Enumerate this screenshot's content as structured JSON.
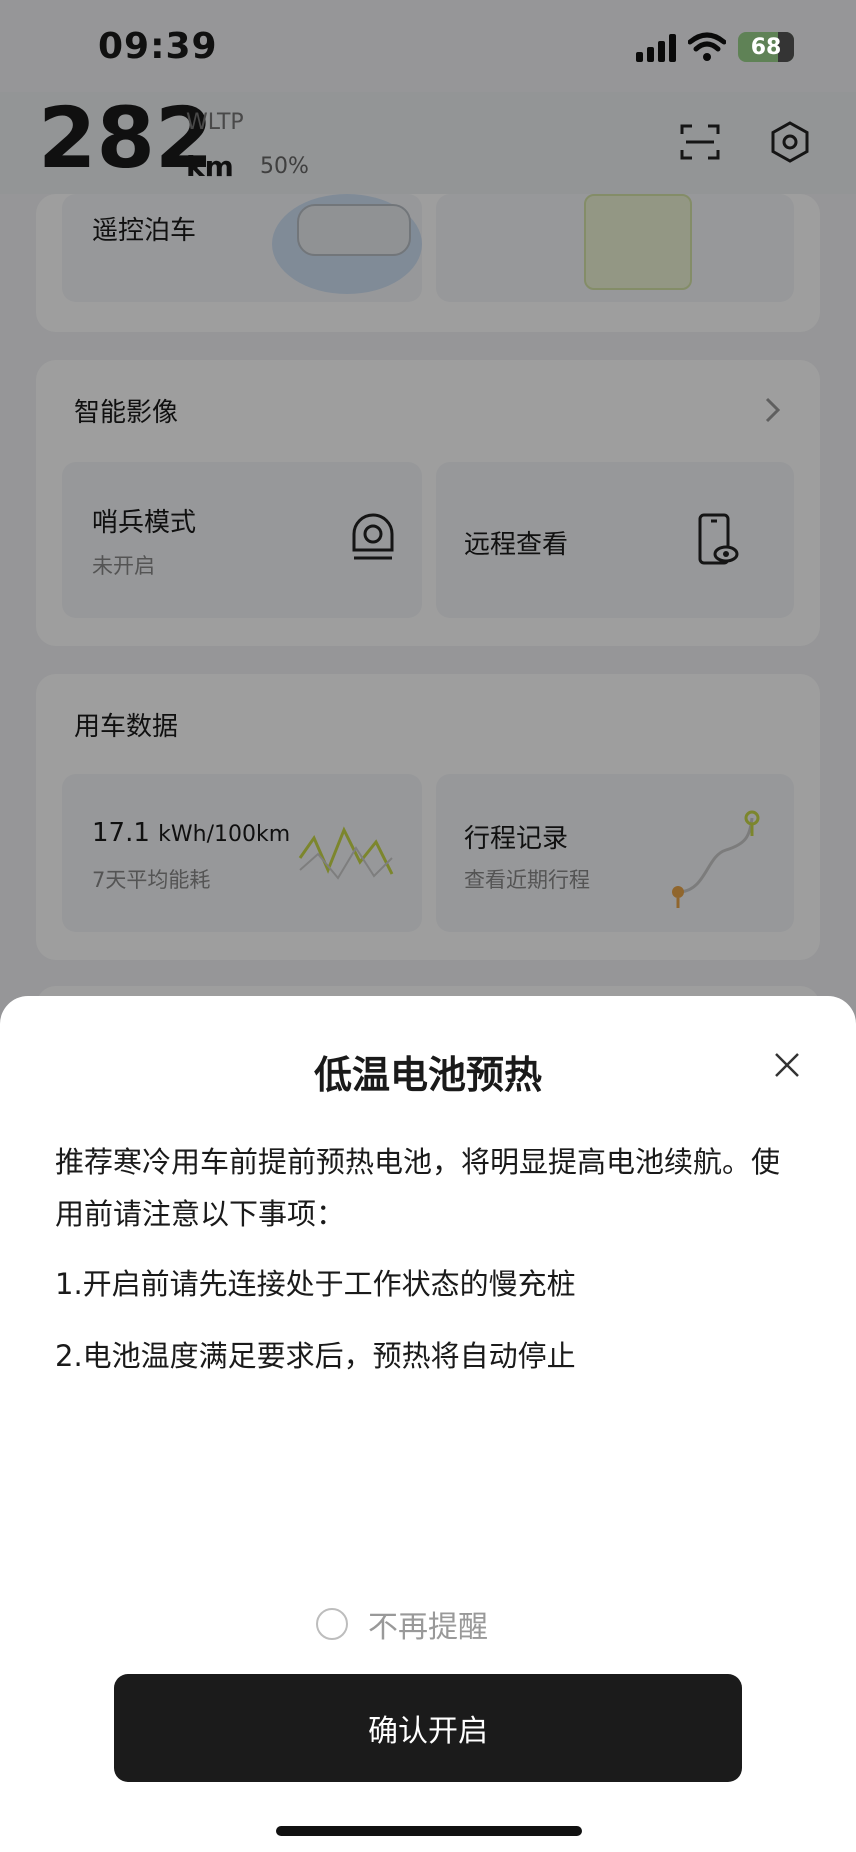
{
  "status_bar": {
    "time": "09:39",
    "battery": "68"
  },
  "header": {
    "range": "282",
    "standard": "WLTP",
    "unit": "km",
    "battery_percent": "50%"
  },
  "remote_parking": {
    "label": "遥控泊车"
  },
  "smart_imaging": {
    "title": "智能影像",
    "sentry": {
      "title": "哨兵模式",
      "status": "未开启"
    },
    "remote_view": {
      "title": "远程查看"
    }
  },
  "vehicle_data": {
    "title": "用车数据",
    "energy": {
      "value": "17.1",
      "unit": "kWh/100km",
      "sub": "7天平均能耗"
    },
    "trips": {
      "title": "行程记录",
      "sub": "查看近期行程"
    }
  },
  "dialog": {
    "title": "低温电池预热",
    "intro": "推荐寒冷用车前提前预热电池，将明显提高电池续航。使用前请注意以下事项：",
    "item1": "1.开启前请先连接处于工作状态的慢充桩",
    "item2": "2.电池温度满足要求后，预热将自动停止",
    "dont_remind": "不再提醒",
    "confirm": "确认开启"
  }
}
